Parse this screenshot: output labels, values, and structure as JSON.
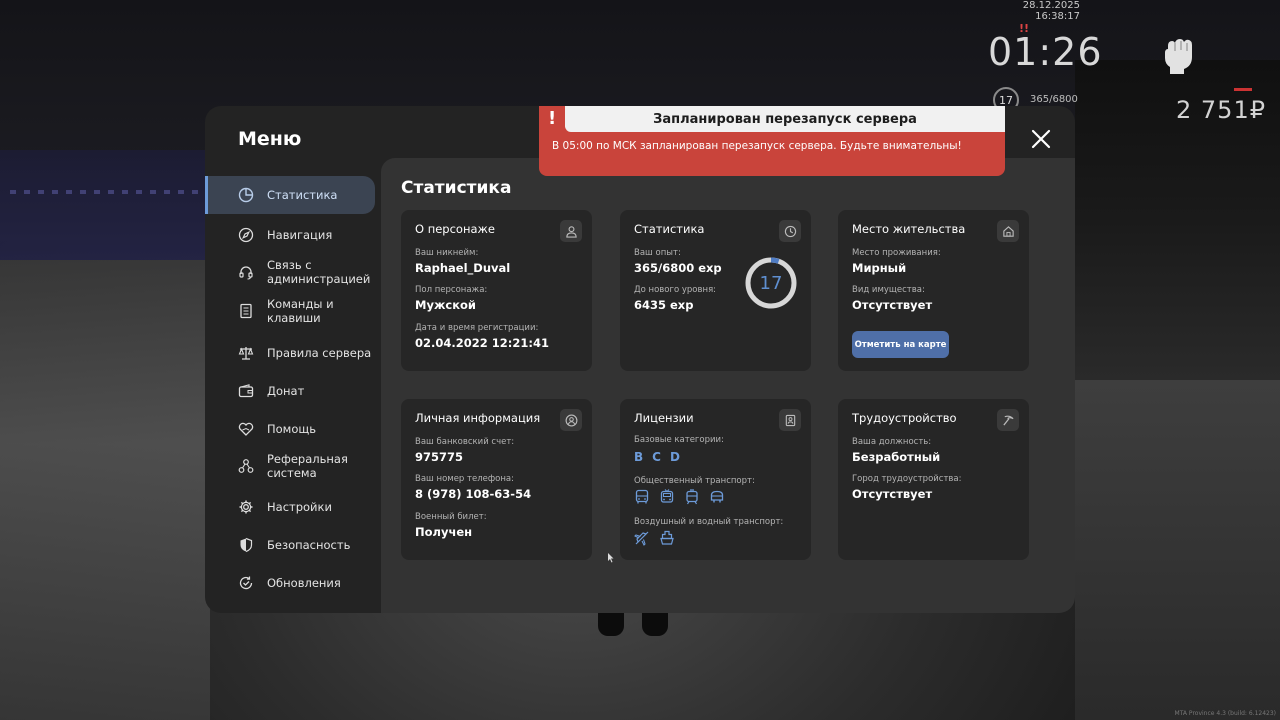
{
  "hud": {
    "datetime": "28.12.2025 16:38:17",
    "alert_mark": "!!",
    "timer": "01:26",
    "level": "17",
    "exp": "365/6800",
    "money": "2 751₽",
    "build": "MTA Province 4.3 (build: 6.12423)"
  },
  "notification": {
    "title": "Запланирован перезапуск сервера",
    "message": "В 05:00 по МСК запланирован перезапуск сервера. Будьте внимательны!",
    "color": "#c9443b"
  },
  "menu": {
    "title": "Меню",
    "accent": "#6d9bd9",
    "sidebar": [
      {
        "label": "Статистика",
        "icon": "pie-chart-icon",
        "active": true
      },
      {
        "label": "Навигация",
        "icon": "compass-icon",
        "active": false
      },
      {
        "label": "Связь с администрацией",
        "icon": "headset-icon",
        "active": false
      },
      {
        "label": "Команды и клавиши",
        "icon": "document-icon",
        "active": false
      },
      {
        "label": "Правила сервера",
        "icon": "scales-icon",
        "active": false
      },
      {
        "label": "Донат",
        "icon": "wallet-icon",
        "active": false
      },
      {
        "label": "Помощь",
        "icon": "heart-hands-icon",
        "active": false
      },
      {
        "label": "Реферальная система",
        "icon": "referral-icon",
        "active": false
      },
      {
        "label": "Настройки",
        "icon": "gear-icon",
        "active": false
      },
      {
        "label": "Безопасность",
        "icon": "shield-icon",
        "active": false
      },
      {
        "label": "Обновления",
        "icon": "update-check-icon",
        "active": false
      }
    ],
    "content_title": "Статистика",
    "cards": {
      "character": {
        "title": "О персонаже",
        "fields": [
          {
            "label": "Ваш никнейм:",
            "value": "Raphael_Duval"
          },
          {
            "label": "Пол персонажа:",
            "value": "Мужской"
          },
          {
            "label": "Дата и время регистрации:",
            "value": "02.04.2022 12:21:41"
          }
        ]
      },
      "stats": {
        "title": "Статистика",
        "fields": [
          {
            "label": "Ваш опыт:",
            "value": "365/6800 exp"
          },
          {
            "label": "До нового уровня:",
            "value": "6435 exp"
          }
        ],
        "level": "17",
        "progress": 0.054
      },
      "residence": {
        "title": "Место жительства",
        "fields": [
          {
            "label": "Место проживания:",
            "value": "Мирный"
          },
          {
            "label": "Вид имущества:",
            "value": "Отсутствует"
          }
        ],
        "button": "Отметить на карте"
      },
      "personal": {
        "title": "Личная информация",
        "fields": [
          {
            "label": "Ваш банковский счет:",
            "value": "975775"
          },
          {
            "label": "Ваш номер телефона:",
            "value": "8 (978) 108-63-54"
          },
          {
            "label": "Военный билет:",
            "value": "Получен"
          }
        ]
      },
      "licenses": {
        "title": "Лицензии",
        "base_label": "Базовые категории:",
        "base_categories": [
          "B",
          "C",
          "D"
        ],
        "public_label": "Общественный транспорт:",
        "public_icons": [
          "bus-icon",
          "trolleybus-icon",
          "tram-icon",
          "minibus-icon"
        ],
        "air_water_label": "Воздушный и водный транспорт:",
        "air_water_icons": [
          "plane-icon",
          "boat-icon"
        ]
      },
      "employment": {
        "title": "Трудоустройство",
        "fields": [
          {
            "label": "Ваша должность:",
            "value": "Безработный"
          },
          {
            "label": "Город трудоустройства:",
            "value": "Отсутствует"
          }
        ]
      }
    }
  }
}
